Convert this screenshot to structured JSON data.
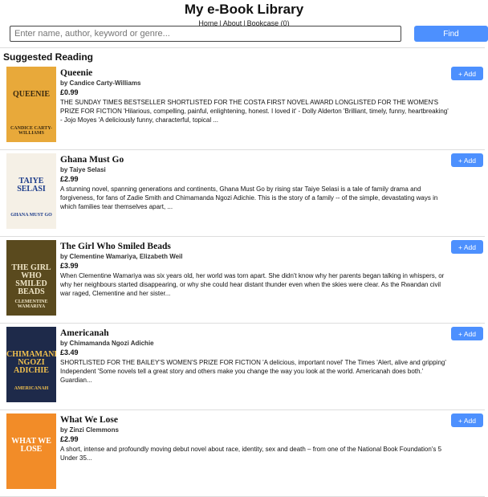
{
  "header": {
    "title": "My e-Book Library",
    "nav": [
      {
        "label": "Home"
      },
      {
        "label": "About"
      },
      {
        "label": "Bookcase (0)"
      }
    ]
  },
  "search": {
    "placeholder": "Enter name, author, keyword or genre...",
    "value": "",
    "button_label": "Find"
  },
  "section_title": "Suggested Reading",
  "colors": {
    "accent": "#4d90fe"
  },
  "books": [
    {
      "title": "Queenie",
      "author": "by Candice Carty-Williams",
      "price": "£0.99",
      "description": "THE SUNDAY TIMES BESTSELLER SHORTLISTED FOR THE COSTA FIRST NOVEL AWARD LONGLISTED FOR THE WOMEN'S PRIZE FOR FICTION 'Hilarious, compelling, painful, enlightening, honest. I loved it' - Dolly Alderton 'Brilliant, timely, funny, heartbreaking' - Jojo Moyes 'A deliciously funny, characterful, topical ...",
      "add_label": "+ Add",
      "cover_title": "QUEENIE",
      "cover_author": "CANDICE CARTY-WILLIAMS",
      "cover_bg": "#e8a93a",
      "cover_fg": "#3a2a10"
    },
    {
      "title": "Ghana Must Go",
      "author": "by Taiye Selasi",
      "price": "£2.99",
      "description": "A stunning novel, spanning generations and continents, Ghana Must Go by rising star Taiye Selasi is a tale of family drama and forgiveness, for fans of Zadie Smith and Chimamanda Ngozi Adichie. This is the story of a family -- of the simple, devastating ways in which families tear themselves apart, ...",
      "add_label": "+ Add",
      "cover_title": "TAIYE SELASI",
      "cover_author": "GHANA MUST GO",
      "cover_bg": "#f5f0e6",
      "cover_fg": "#1a3a8a"
    },
    {
      "title": "The Girl Who Smiled Beads",
      "author": "by Clementine Wamariya, Elizabeth Weil",
      "price": "£3.99",
      "description": "When Clementine Wamariya was six years old, her world was torn apart. She didn't know why her parents began talking in whispers, or why her neighbours started disappearing, or why she could hear distant thunder even when the skies were clear. As the Rwandan civil war raged, Clementine and her sister...",
      "add_label": "+ Add",
      "cover_title": "THE GIRL WHO SMILED BEADS",
      "cover_author": "CLEMENTINE WAMARIYA",
      "cover_bg": "#5a4a1e",
      "cover_fg": "#f0e6c8"
    },
    {
      "title": "Americanah",
      "author": "by Chimamanda Ngozi Adichie",
      "price": "£3.49",
      "description": "SHORTLISTED FOR THE BAILEY'S WOMEN'S PRIZE FOR FICTION 'A delicious, important novel' The Times 'Alert, alive and gripping' Independent 'Some novels tell a great story and others make you change the way you look at the world. Americanah does both.' Guardian...",
      "add_label": "+ Add",
      "cover_title": "CHIMAMANDA NGOZI ADICHIE",
      "cover_author": "AMERICANAH",
      "cover_bg": "#1e2a4a",
      "cover_fg": "#f2c14e"
    },
    {
      "title": "What We Lose",
      "author": "by Zinzi Clemmons",
      "price": "£2.99",
      "description": "A short, intense and profoundly moving debut novel about race, identity, sex and death – from one of the National Book Foundation's 5 Under 35...",
      "add_label": "+ Add",
      "cover_title": "WHAT WE LOSE",
      "cover_author": "",
      "cover_bg": "#f28c28",
      "cover_fg": "#ffffff"
    }
  ]
}
